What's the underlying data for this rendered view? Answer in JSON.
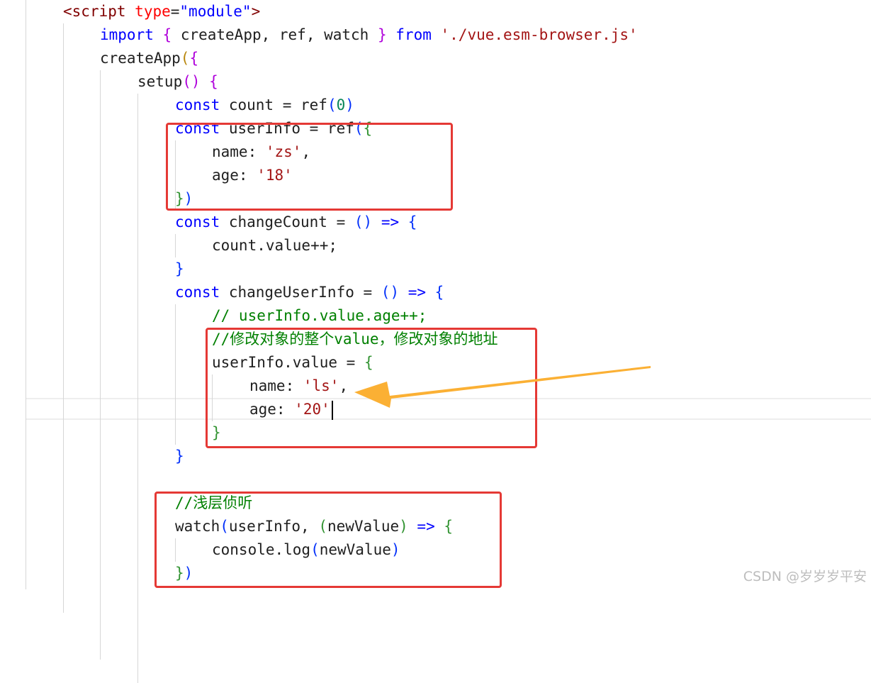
{
  "colors": {
    "tag": "#800000",
    "attr": "#ff0000",
    "string": "#a31515",
    "keyword": "#0000ff",
    "plain": "#1f1f1f",
    "comment": "#008000",
    "number": "#098658",
    "bracket_yellow": "#b8860b",
    "bracket_purple": "#af00db",
    "bracket_blue": "#0431fa",
    "paren_green": "#319331",
    "highlight_box": "#e53935",
    "arrow": "#fbb034"
  },
  "code": {
    "lines": [
      {
        "tokens": [
          {
            "t": "<",
            "c": "tag"
          },
          {
            "t": "script",
            "c": "tag"
          },
          {
            "t": " ",
            "c": "plain"
          },
          {
            "t": "type",
            "c": "attr"
          },
          {
            "t": "=",
            "c": "plain"
          },
          {
            "t": "\"module\"",
            "c": "keyword"
          },
          {
            "t": ">",
            "c": "tag"
          }
        ]
      },
      {
        "tokens": [
          {
            "t": "import",
            "c": "keyword"
          },
          {
            "t": " ",
            "c": "plain"
          },
          {
            "t": "{",
            "c": "bracket_purple"
          },
          {
            "t": " createApp, ref, watch ",
            "c": "plain"
          },
          {
            "t": "}",
            "c": "bracket_purple"
          },
          {
            "t": " ",
            "c": "plain"
          },
          {
            "t": "from",
            "c": "keyword"
          },
          {
            "t": " ",
            "c": "plain"
          },
          {
            "t": "'./vue.esm-browser.js'",
            "c": "string"
          }
        ]
      },
      {
        "tokens": [
          {
            "t": "createApp",
            "c": "plain"
          },
          {
            "t": "(",
            "c": "bracket_yellow"
          },
          {
            "t": "{",
            "c": "bracket_purple"
          }
        ]
      },
      {
        "tokens": [
          {
            "t": "setup",
            "c": "plain"
          },
          {
            "t": "()",
            "c": "bracket_purple"
          },
          {
            "t": " ",
            "c": "plain"
          },
          {
            "t": "{",
            "c": "bracket_purple"
          }
        ]
      },
      {
        "tokens": [
          {
            "t": "const",
            "c": "keyword"
          },
          {
            "t": " count = ref",
            "c": "plain"
          },
          {
            "t": "(",
            "c": "bracket_blue"
          },
          {
            "t": "0",
            "c": "number"
          },
          {
            "t": ")",
            "c": "bracket_blue"
          }
        ]
      },
      {
        "tokens": [
          {
            "t": "const",
            "c": "keyword"
          },
          {
            "t": " userInfo = ref",
            "c": "plain"
          },
          {
            "t": "(",
            "c": "bracket_blue"
          },
          {
            "t": "{",
            "c": "paren_green"
          }
        ]
      },
      {
        "tokens": [
          {
            "t": "name: ",
            "c": "plain"
          },
          {
            "t": "'zs'",
            "c": "string"
          },
          {
            "t": ",",
            "c": "plain"
          }
        ]
      },
      {
        "tokens": [
          {
            "t": "age: ",
            "c": "plain"
          },
          {
            "t": "'18'",
            "c": "string"
          }
        ]
      },
      {
        "tokens": [
          {
            "t": "}",
            "c": "paren_green"
          },
          {
            "t": ")",
            "c": "bracket_blue"
          }
        ]
      },
      {
        "tokens": [
          {
            "t": "const",
            "c": "keyword"
          },
          {
            "t": " changeCount = ",
            "c": "plain"
          },
          {
            "t": "()",
            "c": "bracket_blue"
          },
          {
            "t": " => ",
            "c": "keyword"
          },
          {
            "t": "{",
            "c": "bracket_blue"
          }
        ]
      },
      {
        "tokens": [
          {
            "t": "count.value++;",
            "c": "plain"
          }
        ]
      },
      {
        "tokens": [
          {
            "t": "}",
            "c": "bracket_blue"
          }
        ]
      },
      {
        "tokens": [
          {
            "t": "const",
            "c": "keyword"
          },
          {
            "t": " changeUserInfo = ",
            "c": "plain"
          },
          {
            "t": "()",
            "c": "bracket_blue"
          },
          {
            "t": " => ",
            "c": "keyword"
          },
          {
            "t": "{",
            "c": "bracket_blue"
          }
        ]
      },
      {
        "tokens": [
          {
            "t": "// userInfo.value.age++;",
            "c": "comment"
          }
        ]
      },
      {
        "tokens": [
          {
            "t": "//修改对象的整个value，修改对象的地址",
            "c": "comment"
          }
        ]
      },
      {
        "tokens": [
          {
            "t": "userInfo.value = ",
            "c": "plain"
          },
          {
            "t": "{",
            "c": "paren_green"
          }
        ]
      },
      {
        "tokens": [
          {
            "t": "name: ",
            "c": "plain"
          },
          {
            "t": "'ls'",
            "c": "string"
          },
          {
            "t": ",",
            "c": "plain"
          }
        ]
      },
      {
        "tokens": [
          {
            "t": "age: ",
            "c": "plain"
          },
          {
            "t": "'20'",
            "c": "string"
          }
        ]
      },
      {
        "tokens": [
          {
            "t": "}",
            "c": "paren_green"
          }
        ]
      },
      {
        "tokens": [
          {
            "t": "}",
            "c": "bracket_blue"
          }
        ]
      },
      {
        "tokens": []
      },
      {
        "tokens": [
          {
            "t": "//浅层侦听",
            "c": "comment"
          }
        ]
      },
      {
        "tokens": [
          {
            "t": "watch",
            "c": "plain"
          },
          {
            "t": "(",
            "c": "bracket_blue"
          },
          {
            "t": "userInfo, ",
            "c": "plain"
          },
          {
            "t": "(",
            "c": "paren_green"
          },
          {
            "t": "newValue",
            "c": "plain"
          },
          {
            "t": ")",
            "c": "paren_green"
          },
          {
            "t": " => ",
            "c": "keyword"
          },
          {
            "t": "{",
            "c": "paren_green"
          }
        ]
      },
      {
        "tokens": [
          {
            "t": "console.log",
            "c": "plain"
          },
          {
            "t": "(",
            "c": "bracket_blue"
          },
          {
            "t": "newValue",
            "c": "plain"
          },
          {
            "t": ")",
            "c": "bracket_blue"
          }
        ]
      },
      {
        "tokens": [
          {
            "t": "}",
            "c": "paren_green"
          },
          {
            "t": ")",
            "c": "bracket_blue"
          }
        ]
      }
    ]
  },
  "watermark": "CSDN @岁岁岁平安"
}
